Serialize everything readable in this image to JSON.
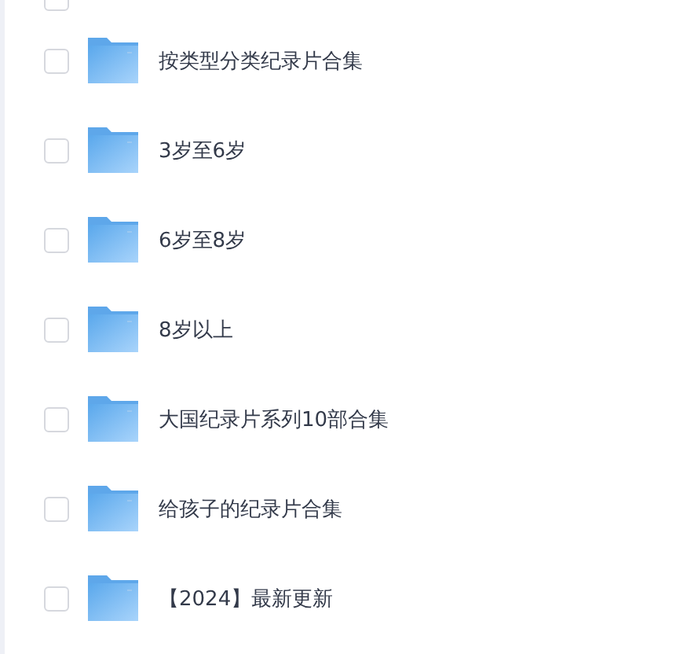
{
  "partial_row": {
    "selected": false
  },
  "folders": [
    {
      "name": "按类型分类纪录片合集",
      "selected": false
    },
    {
      "name": "3岁至6岁",
      "selected": false
    },
    {
      "name": "6岁至8岁",
      "selected": false
    },
    {
      "name": "8岁以上",
      "selected": false
    },
    {
      "name": "大国纪录片系列10部合集",
      "selected": false
    },
    {
      "name": "给孩子的纪录片合集",
      "selected": false
    },
    {
      "name": "【2024】最新更新",
      "selected": false
    }
  ]
}
